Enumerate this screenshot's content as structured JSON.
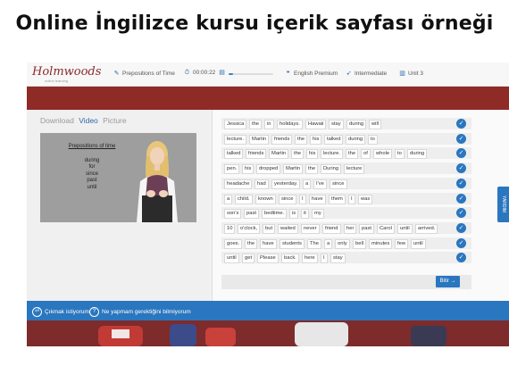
{
  "page_title": "Online İngilizce kursu içerik sayfası örneği",
  "app": {
    "logo": "Holmwoods",
    "logo_subtitle": "online learning"
  },
  "toolbar": {
    "lesson": "Prepositions of Time",
    "timer": "00:00:22",
    "progress": 0.1,
    "course": "English Premium",
    "level": "Intermediate",
    "unit": "Unit 3"
  },
  "media_tabs": [
    "Download",
    "Video",
    "Picture"
  ],
  "active_tab": 1,
  "slide": {
    "title": "Prepositions of time",
    "items": [
      "during",
      "for",
      "since",
      "past",
      "until"
    ]
  },
  "exercise_rows": [
    [
      "Jessica",
      "the",
      "in",
      "holidays.",
      "Hawaii",
      "stay",
      "during",
      "will"
    ],
    [
      "lecture.",
      "Martin",
      "friends",
      "the",
      "his",
      "talked",
      "during",
      "to"
    ],
    [
      "talked",
      "friends",
      "Martin",
      "the",
      "his",
      "lecture.",
      "the",
      "of",
      "whole",
      "to",
      "during"
    ],
    [
      "pen.",
      "his",
      "dropped",
      "Martin",
      "the",
      "During",
      "lecture"
    ],
    [
      "headache",
      "had",
      "yesterday.",
      "a",
      "I've",
      "since"
    ],
    [
      "a",
      "child.",
      "known",
      "since",
      "I",
      "have",
      "them",
      "I",
      "was"
    ],
    [
      "son's",
      "past",
      "bedtime.",
      "is",
      "it",
      "my"
    ],
    [
      "10",
      "o'clock,",
      "but",
      "waited",
      "never",
      "friend",
      "her",
      "past",
      "Carol",
      "until",
      "arrived."
    ],
    [
      "goes.",
      "the",
      "have",
      "students",
      "The",
      "a",
      "only",
      "bell",
      "minutes",
      "few",
      "until"
    ],
    [
      "until",
      "get",
      "Please",
      "back.",
      "here",
      "I",
      "stay"
    ]
  ],
  "next_button": "Bitir →",
  "side_tab": "YARDIM",
  "bottom": {
    "quit_label": "Çıkmak istiyorum",
    "help_label": "Ne yapmam gerektiğini bilmiyorum"
  },
  "colors": {
    "accent": "#2a76bf",
    "band": "#8e2b26",
    "logo": "#8a2a2a"
  },
  "icons": {
    "lesson": "pencil-icon",
    "timer": "stopwatch-icon",
    "progress": "progress-icon",
    "course": "speech-bubbles-icon",
    "level": "rocket-icon",
    "unit": "book-icon",
    "check": "checkmark-icon",
    "quit": "exit-icon",
    "help": "question-icon"
  }
}
